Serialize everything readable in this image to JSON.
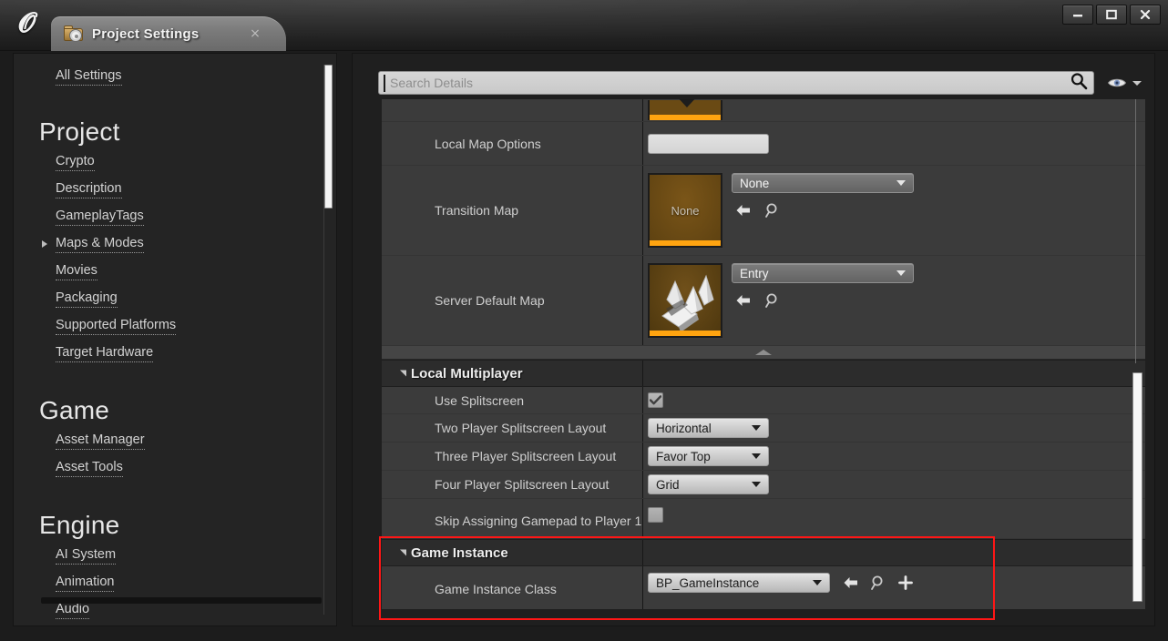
{
  "window": {
    "logo": "unreal-engine-logo",
    "tab": {
      "title": "Project Settings",
      "icon": "project-settings-folder-gear-icon",
      "close": "×"
    },
    "controls": {
      "minimize": "minimize-icon",
      "maximize": "maximize-icon",
      "close": "close-icon"
    }
  },
  "sidebar": {
    "all_settings": "All Settings",
    "sections": [
      {
        "title": "Project",
        "items": [
          {
            "label": "Crypto",
            "expandable": false
          },
          {
            "label": "Description",
            "expandable": false
          },
          {
            "label": "GameplayTags",
            "expandable": false
          },
          {
            "label": "Maps & Modes",
            "expandable": true
          },
          {
            "label": "Movies",
            "expandable": false
          },
          {
            "label": "Packaging",
            "expandable": false
          },
          {
            "label": "Supported Platforms",
            "expandable": false
          },
          {
            "label": "Target Hardware",
            "expandable": false
          }
        ]
      },
      {
        "title": "Game",
        "items": [
          {
            "label": "Asset Manager",
            "expandable": false
          },
          {
            "label": "Asset Tools",
            "expandable": false
          }
        ]
      },
      {
        "title": "Engine",
        "items": [
          {
            "label": "AI System",
            "expandable": false
          },
          {
            "label": "Animation",
            "expandable": false
          },
          {
            "label": "Audio",
            "expandable": false
          }
        ]
      }
    ]
  },
  "details": {
    "search": {
      "value": "",
      "placeholder": "Search Details",
      "icon": "search-magnifier-icon"
    },
    "view_options": {
      "icon": "eye-icon",
      "caret": "chevron-down-icon"
    },
    "rows": {
      "local_map_options": {
        "label": "Local Map Options",
        "value": ""
      },
      "transition_map": {
        "label": "Transition Map",
        "thumbnail_label": "None",
        "value": "None",
        "back_icon": "back-arrow-icon",
        "browse_icon": "browse-magnifier-icon"
      },
      "server_default_map": {
        "label": "Server Default Map",
        "thumbnail_label": "",
        "value": "Entry",
        "back_icon": "back-arrow-icon",
        "browse_icon": "browse-magnifier-icon"
      }
    },
    "local_multiplayer": {
      "title": "Local Multiplayer",
      "rows": [
        {
          "label": "Use Splitscreen",
          "type": "checkbox",
          "checked": true
        },
        {
          "label": "Two Player Splitscreen Layout",
          "type": "dropdown",
          "value": "Horizontal"
        },
        {
          "label": "Three Player Splitscreen Layout",
          "type": "dropdown",
          "value": "Favor Top"
        },
        {
          "label": "Four Player Splitscreen Layout",
          "type": "dropdown",
          "value": "Grid"
        },
        {
          "label": "Skip Assigning Gamepad to Player 1",
          "type": "checkbox",
          "checked": false
        }
      ]
    },
    "game_instance": {
      "title": "Game Instance",
      "row": {
        "label": "Game Instance Class",
        "value": "BP_GameInstance",
        "back_icon": "back-arrow-icon",
        "browse_icon": "browse-magnifier-icon",
        "add_icon": "plus-icon"
      },
      "highlight_color": "#ff1616"
    }
  },
  "colors": {
    "accent_orange": "#ffa410",
    "panel_bg": "#3b3b3b",
    "section_bg": "#2c2c2c",
    "highlight": "#ff1616"
  }
}
